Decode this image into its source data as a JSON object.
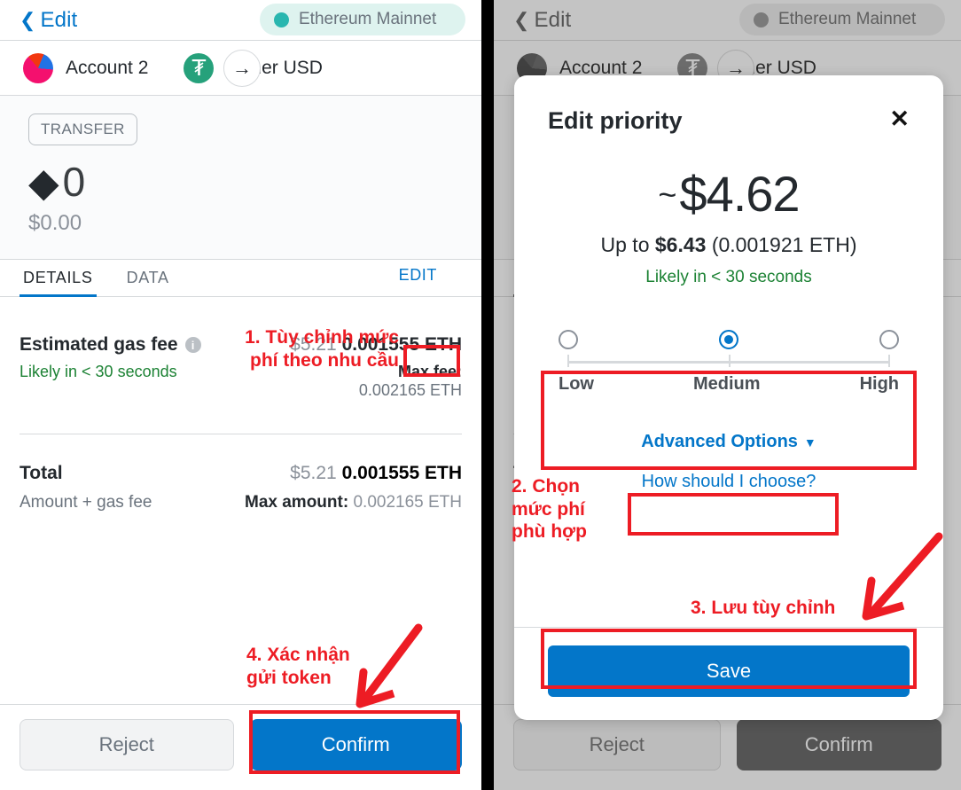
{
  "confirm_screen": {
    "topbar": {
      "back_label": "Edit",
      "back_icon": "chevron-left-icon",
      "network": "Ethereum Mainnet",
      "network_dot_color": "#29b6af"
    },
    "parties": {
      "from_account": "Account 2",
      "to_token": "Tether USD",
      "arrow_icon": "arrow-right-icon"
    },
    "hero": {
      "tag": "TRANSFER",
      "eth_icon": "ethereum-diamond-icon",
      "amount": "0",
      "fiat": "$0.00"
    },
    "tabs": [
      {
        "label": "DETAILS",
        "active": true
      },
      {
        "label": "DATA",
        "active": false
      }
    ],
    "gas": {
      "edit_label": "EDIT",
      "label": "Estimated gas fee",
      "info_icon": "info-icon",
      "fiat": "$5.21",
      "eth": "0.001555 ETH",
      "likely": "Likely in < 30 seconds",
      "max_fee_label": "Max fee:",
      "max_fee_value": "0.002165 ETH"
    },
    "total": {
      "label": "Total",
      "fiat": "$5.21",
      "eth": "0.001555 ETH",
      "sub_label": "Amount + gas fee",
      "max_amount_label": "Max amount:",
      "max_amount_value": "0.002165 ETH"
    },
    "footer": {
      "reject": "Reject",
      "confirm": "Confirm"
    }
  },
  "modal": {
    "title": "Edit priority",
    "close_icon": "close-icon",
    "price_tilde": "~",
    "price": "$4.62",
    "upto_prefix": "Up to ",
    "upto_amount": "$6.43",
    "upto_eth": " (0.001921 ETH)",
    "likely": "Likely in < 30 seconds",
    "options": [
      {
        "label": "Low",
        "selected": false
      },
      {
        "label": "Medium",
        "selected": true
      },
      {
        "label": "High",
        "selected": false
      }
    ],
    "advanced_options": "Advanced Options",
    "advanced_caret_icon": "caret-down-icon",
    "how_link": "How should I choose?",
    "save": "Save"
  },
  "annotations": {
    "step1": "1. Tùy chỉnh mức\nphí theo nhu cầu",
    "step2": "2. Chọn\nmức phí\nphù hợp",
    "step3": "3. Lưu tùy chỉnh",
    "step4": "4. Xác nhận\ngửi token"
  },
  "colors": {
    "accent": "#0376c9",
    "annotation": "#ed1c24",
    "success": "#1c8234",
    "muted": "#6a737d"
  }
}
